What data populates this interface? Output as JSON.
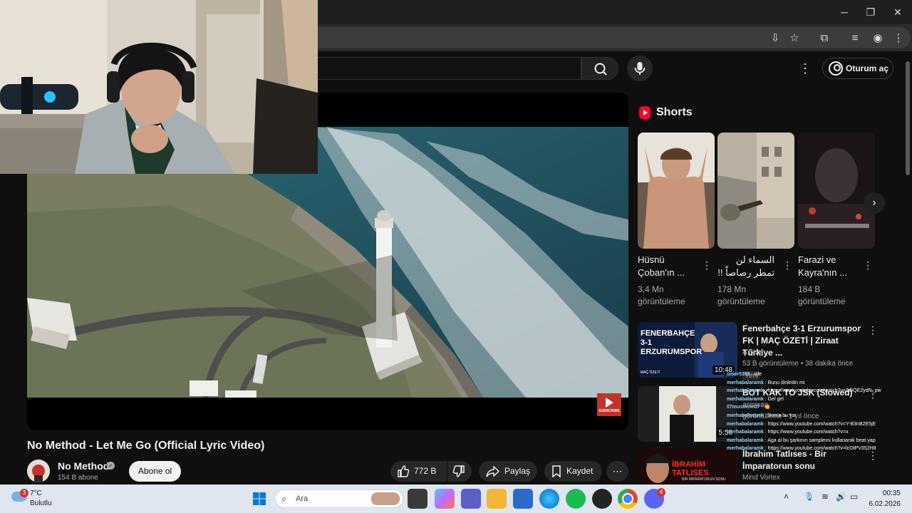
{
  "browser": {
    "window_controls": [
      "minimize",
      "restore",
      "close"
    ]
  },
  "youtube": {
    "sign_in_label": "Oturum aç",
    "video": {
      "title": "No Method - Let Me Go (Official Lyric Video)",
      "channel": "No Method",
      "subscribers": "154 B abone",
      "subscribe_label": "Abone ol",
      "likes": "772 B",
      "share_label": "Paylaş",
      "save_label": "Kaydet",
      "subscribe_overlay": "SUBSCRIBE"
    },
    "shorts": {
      "heading": "Shorts",
      "items": [
        {
          "title": "Hüsnü Çoban'ın ...",
          "views": "3,4 Mn görüntüleme"
        },
        {
          "title": "السماء لن تمطر رصاصاً !!",
          "views": "178 Mn görüntüleme"
        },
        {
          "title": "Farazi ve Kayra'nın ...",
          "views": "184 B görüntüleme"
        }
      ]
    },
    "recommendations": [
      {
        "title": "Fenerbahçe 3-1 Erzurumspor FK | MAÇ ÖZETİ | Ziraat Türkiye ...",
        "channel": "A Spor",
        "meta": "53 B görüntüleme • 38 dakika önce",
        "duration": "10:48",
        "badge": "Yeni",
        "thumb_text": "FENERBAHÇE 3-1 ERZURUMSPOR",
        "thumb_sub": "MAÇ ÖZETİ"
      },
      {
        "title": "BOT KAK TO JSK (Slowed)",
        "channel": "asenrap",
        "meta": "görüntüleme • 1 yıl önce",
        "duration": "5:56"
      },
      {
        "title": "İbrahim Tatlıses - Bir İmparatorun sonu",
        "channel": "Mind Vortex",
        "meta": "",
        "thumb_text": "İBRAHİM TATLISES",
        "thumb_sub": "BİR İMPARATORUN SONU"
      }
    ]
  },
  "chat": [
    {
      "user": "omer5355",
      "text": ": izle"
    },
    {
      "user": "merhabalaramk",
      "text": ": Bunu dinledin mi"
    },
    {
      "user": "merhabalaramk",
      "text": ": https://www.youtube.com/watch?v=AOQE2ydN_pw"
    },
    {
      "user": "merhabalaramk",
      "text": ": Gel gel"
    },
    {
      "user": "07musticon07",
      "text": ": 👏"
    },
    {
      "user": "merhabalaramk",
      "text": ": Sonra bu var"
    },
    {
      "user": "merhabalaramk",
      "text": ": https://www.youtube.com/watch?v=Y-B3nB2E5jE"
    },
    {
      "user": "merhabalaramk",
      "text": ": https://www.youtube.com/watch?v=x"
    },
    {
      "user": "merhabalaramk",
      "text": ": Aga al bu şarkının sampleını kullanarak beat yap"
    },
    {
      "user": "merhabalaramk",
      "text": ": https://www.youtube.com/watch?v=lcOtPV352H8"
    }
  ],
  "taskbar": {
    "temperature": "7°C",
    "weather": "Bulutlu",
    "weather_badge": "3",
    "search_placeholder": "Ara",
    "time": "00:35",
    "date": "6.02.2026",
    "discord_badge": "4"
  }
}
